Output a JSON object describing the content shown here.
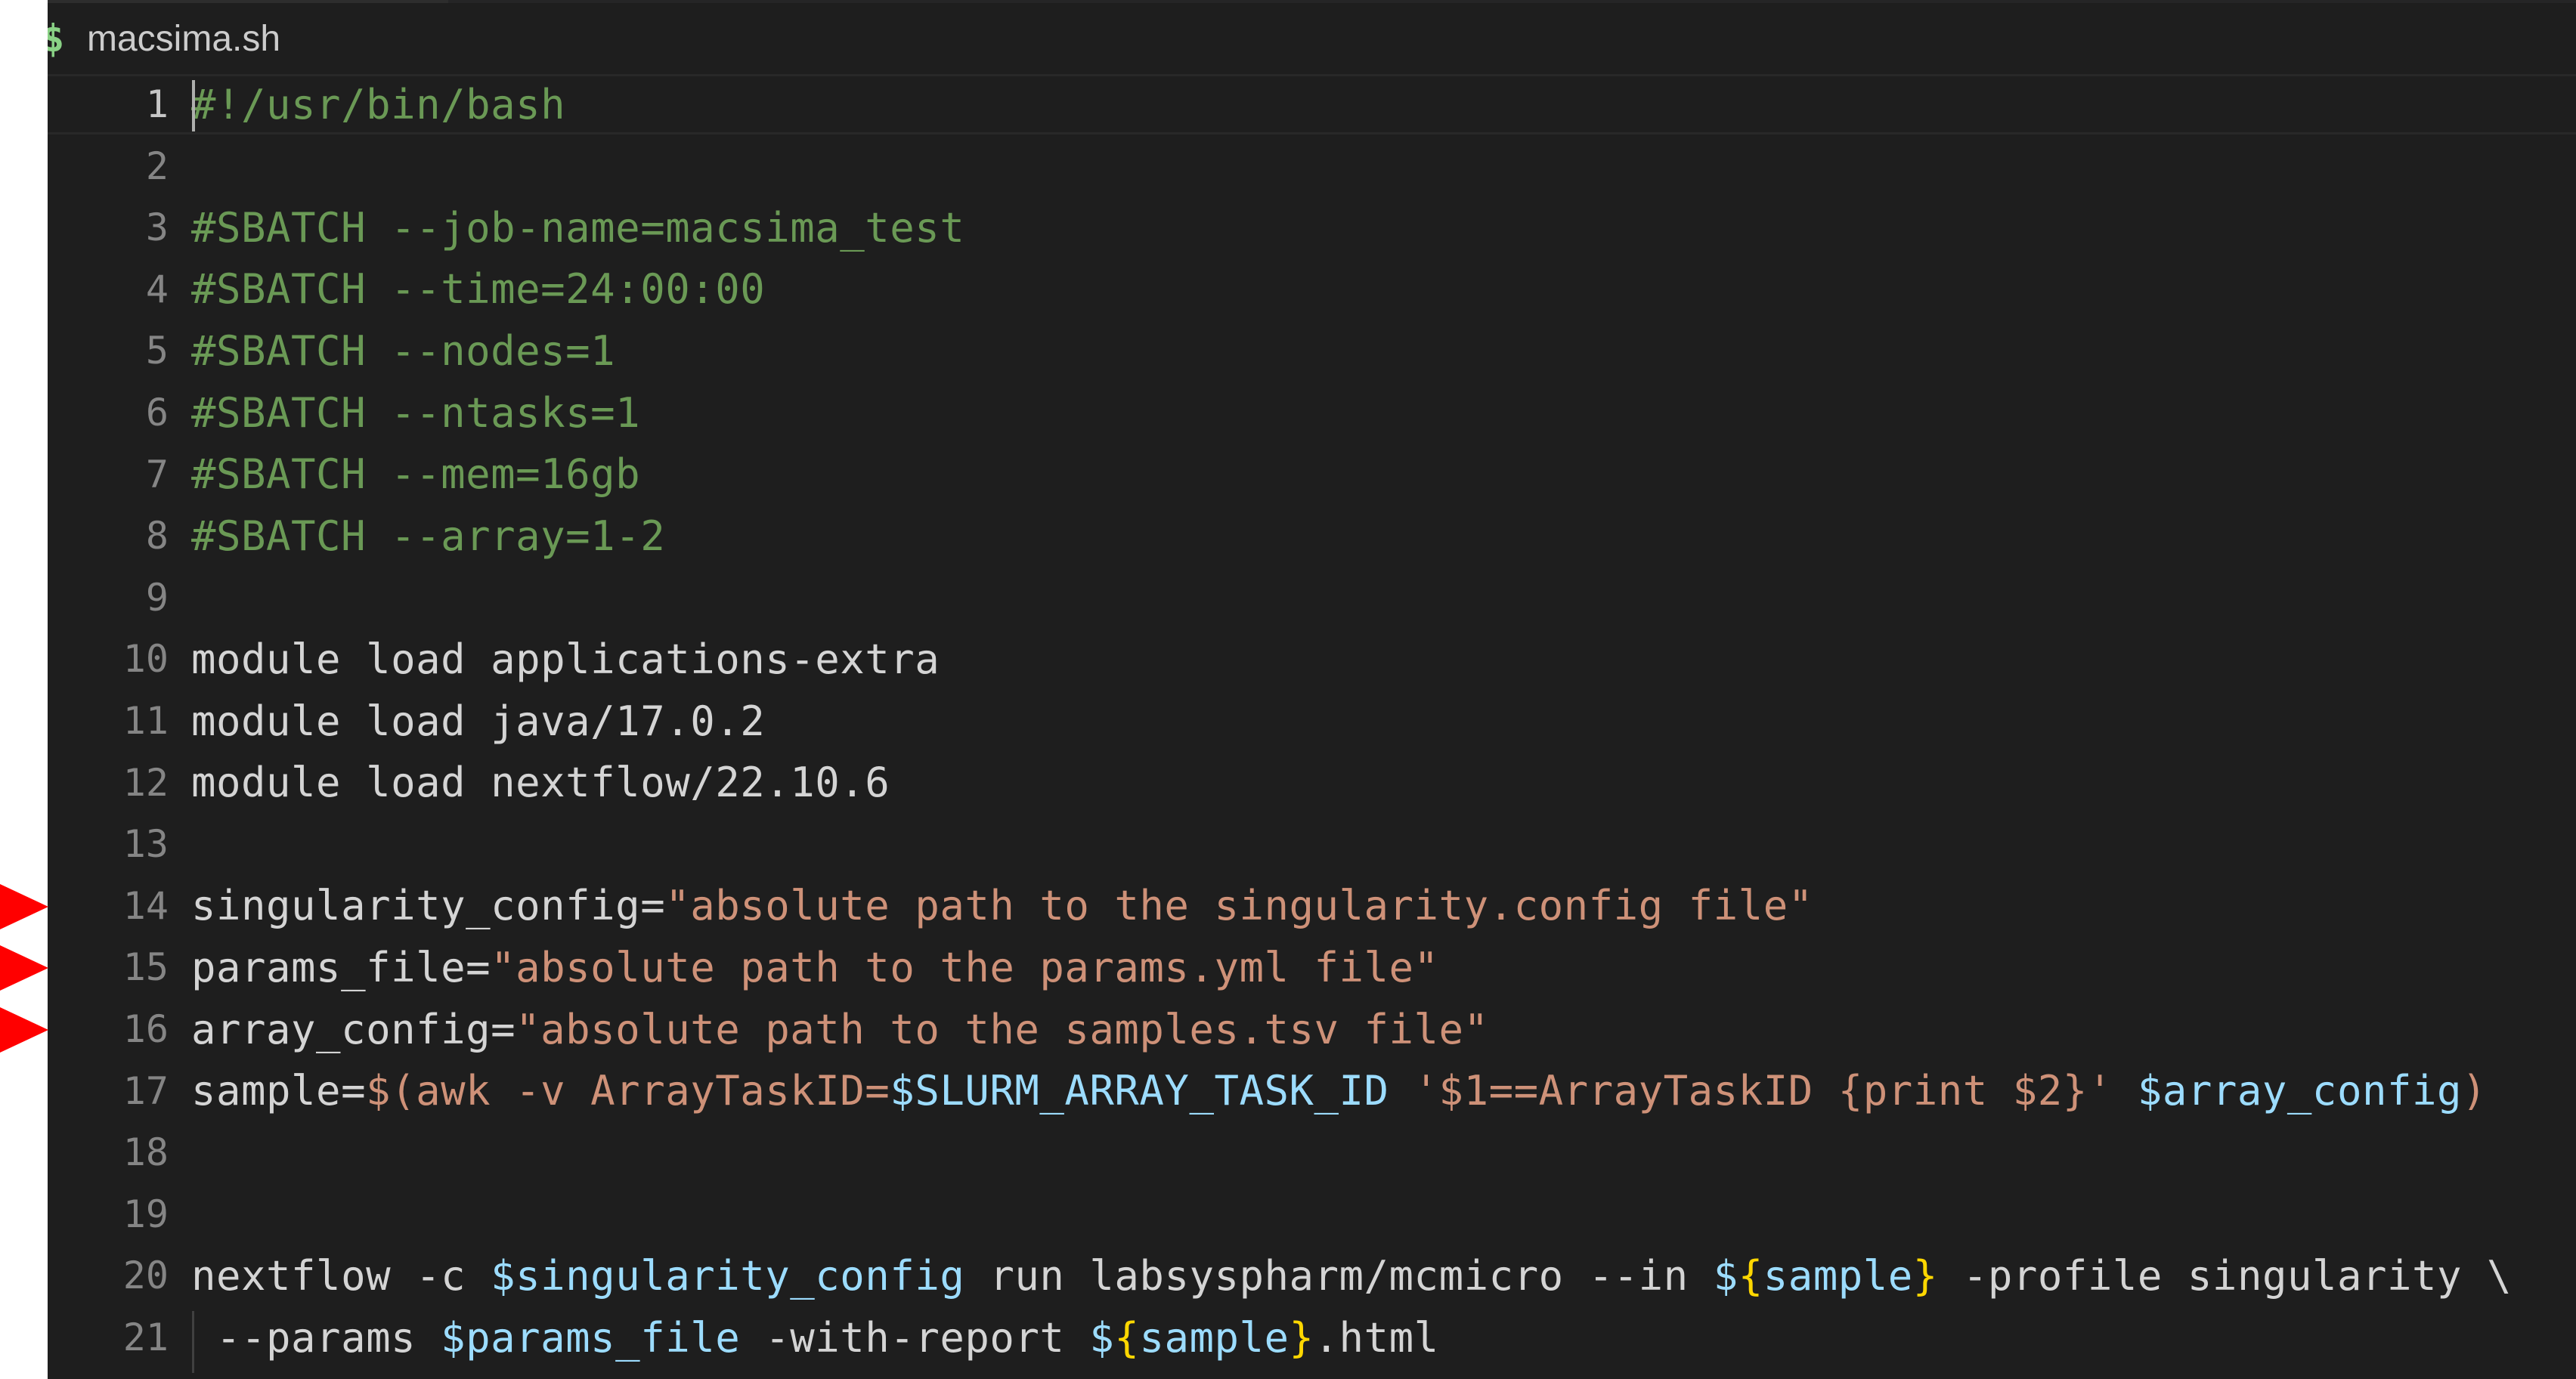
{
  "tab": {
    "icon": "dollar-icon",
    "icon_glyph": "$",
    "label": "macsima.sh"
  },
  "lines": [
    {
      "number": "1",
      "tokens": [
        {
          "text": "#!/usr/bin/bash",
          "kind": "comment"
        }
      ]
    },
    {
      "number": "2",
      "tokens": []
    },
    {
      "number": "3",
      "tokens": [
        {
          "text": "#SBATCH --job-name=macsima_test",
          "kind": "comment"
        }
      ]
    },
    {
      "number": "4",
      "tokens": [
        {
          "text": "#SBATCH --time=24:00:00",
          "kind": "comment"
        }
      ]
    },
    {
      "number": "5",
      "tokens": [
        {
          "text": "#SBATCH --nodes=1",
          "kind": "comment"
        }
      ]
    },
    {
      "number": "6",
      "tokens": [
        {
          "text": "#SBATCH --ntasks=1",
          "kind": "comment"
        }
      ]
    },
    {
      "number": "7",
      "tokens": [
        {
          "text": "#SBATCH --mem=16gb",
          "kind": "comment"
        }
      ]
    },
    {
      "number": "8",
      "tokens": [
        {
          "text": "#SBATCH --array=1-2",
          "kind": "comment"
        }
      ]
    },
    {
      "number": "9",
      "tokens": []
    },
    {
      "number": "10",
      "tokens": [
        {
          "text": "module load applications-extra",
          "kind": "plain"
        }
      ]
    },
    {
      "number": "11",
      "tokens": [
        {
          "text": "module load java/17.0.2",
          "kind": "plain"
        }
      ]
    },
    {
      "number": "12",
      "tokens": [
        {
          "text": "module load nextflow/22.10.6",
          "kind": "plain"
        }
      ]
    },
    {
      "number": "13",
      "tokens": []
    },
    {
      "number": "14",
      "tokens": [
        {
          "text": "singularity_config=",
          "kind": "plain"
        },
        {
          "text": "\"absolute path to the singularity.config file\"",
          "kind": "string"
        }
      ]
    },
    {
      "number": "15",
      "tokens": [
        {
          "text": "params_file=",
          "kind": "plain"
        },
        {
          "text": "\"absolute path to the params.yml file\"",
          "kind": "string"
        }
      ]
    },
    {
      "number": "16",
      "tokens": [
        {
          "text": "array_config=",
          "kind": "plain"
        },
        {
          "text": "\"absolute path to the samples.tsv file\"",
          "kind": "string"
        }
      ]
    },
    {
      "number": "17",
      "tokens": [
        {
          "text": "sample=",
          "kind": "plain"
        },
        {
          "text": "$(awk -v ArrayTaskID=",
          "kind": "string"
        },
        {
          "text": "$SLURM_ARRAY_TASK_ID",
          "kind": "var"
        },
        {
          "text": " '$1==ArrayTaskID {print $2}' ",
          "kind": "string"
        },
        {
          "text": "$array_config",
          "kind": "var"
        },
        {
          "text": ")",
          "kind": "string"
        }
      ]
    },
    {
      "number": "18",
      "tokens": []
    },
    {
      "number": "19",
      "tokens": []
    },
    {
      "number": "20",
      "tokens": [
        {
          "text": "nextflow -c ",
          "kind": "plain"
        },
        {
          "text": "$singularity_config",
          "kind": "var"
        },
        {
          "text": " run labsyspharm/mcmicro --in ",
          "kind": "plain"
        },
        {
          "text": "$",
          "kind": "var"
        },
        {
          "text": "{",
          "kind": "brace"
        },
        {
          "text": "sample",
          "kind": "var"
        },
        {
          "text": "}",
          "kind": "brace"
        },
        {
          "text": " -profile singularity \\",
          "kind": "plain"
        }
      ]
    },
    {
      "number": "21",
      "tokens": [
        {
          "text": " --params ",
          "kind": "plain"
        },
        {
          "text": "$params_file",
          "kind": "var"
        },
        {
          "text": " -with-report ",
          "kind": "plain"
        },
        {
          "text": "$",
          "kind": "var"
        },
        {
          "text": "{",
          "kind": "brace"
        },
        {
          "text": "sample",
          "kind": "var"
        },
        {
          "text": "}",
          "kind": "brace"
        },
        {
          "text": ".html",
          "kind": "plain"
        }
      ]
    }
  ],
  "markers": [
    "14",
    "15",
    "16"
  ],
  "active_line": "1",
  "colors": {
    "comment": "#6a9955",
    "string": "#ce9178",
    "variable": "#9cdcfe",
    "brace": "#ffd700",
    "plain": "#d4d4d4",
    "marker": "#ff0000"
  }
}
